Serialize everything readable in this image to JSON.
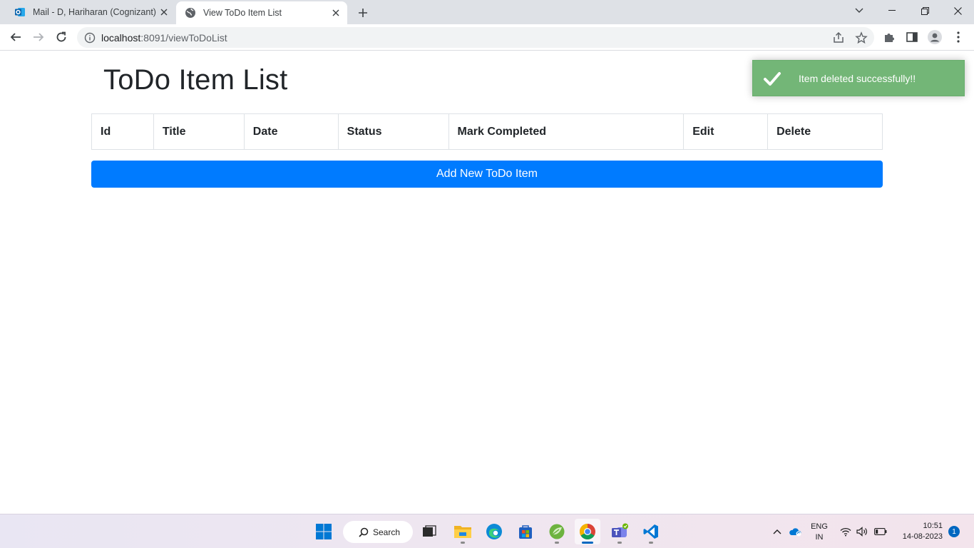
{
  "browser": {
    "tabs": [
      {
        "title": "Mail - D, Hariharan (Cognizant) - Outlook",
        "active": false,
        "icon": "outlook-icon"
      },
      {
        "title": "View ToDo Item List",
        "active": true,
        "icon": "globe-icon"
      }
    ],
    "url_host": "localhost",
    "url_path": ":8091/viewToDoList"
  },
  "page": {
    "title": "ToDo Item List",
    "table": {
      "columns": [
        "Id",
        "Title",
        "Date",
        "Status",
        "Mark Completed",
        "Edit",
        "Delete"
      ]
    },
    "add_button_label": "Add New ToDo Item",
    "toast": {
      "message": "Item deleted successfully!!",
      "color": "#73b677"
    },
    "accent_color": "#007bff"
  },
  "taskbar": {
    "search_label": "Search",
    "lang_line1": "ENG",
    "lang_line2": "IN",
    "time": "10:51",
    "date": "14-08-2023",
    "notification_count": "1"
  }
}
